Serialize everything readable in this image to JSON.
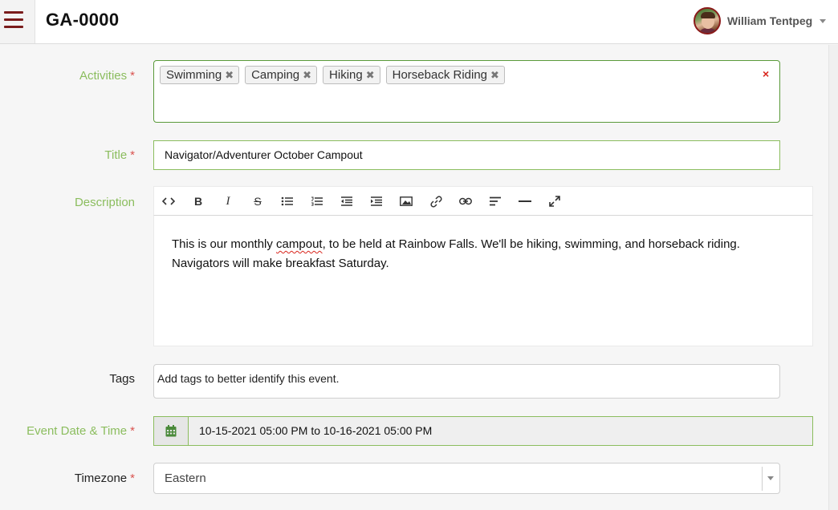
{
  "header": {
    "app_title": "GA-0000",
    "user_name": "William Tentpeg"
  },
  "form": {
    "activities": {
      "label": "Activities",
      "required_mark": "*",
      "chips": [
        "Swimming",
        "Camping",
        "Hiking",
        "Horseback Riding"
      ],
      "chip_remove_glyph": "✖",
      "clear_glyph": "×"
    },
    "title": {
      "label": "Title",
      "required_mark": "*",
      "value": "Navigator/Adventurer October Campout"
    },
    "description": {
      "label": "Description",
      "toolbar": [
        "code-icon",
        "bold-icon",
        "italic-icon",
        "strikethrough-icon",
        "bulleted-list-icon",
        "numbered-list-icon",
        "outdent-icon",
        "indent-icon",
        "image-icon",
        "link-icon",
        "unlink-icon",
        "align-left-icon",
        "horizontal-rule-icon",
        "fullscreen-icon"
      ],
      "text_before": "This is our monthly ",
      "misspelled_word": "campout",
      "text_after": ", to be held at Rainbow Falls.  We'll be hiking, swimming, and horseback riding.",
      "line2": "Navigators will make breakfast Saturday."
    },
    "tags": {
      "label": "Tags",
      "placeholder": "Add tags to better identify this event."
    },
    "event_date": {
      "label": "Event Date & Time",
      "required_mark": "*",
      "value": "10-15-2021 05:00 PM to 10-16-2021 05:00 PM"
    },
    "timezone": {
      "label": "Timezone",
      "required_mark": "*",
      "value": "Eastern"
    }
  },
  "colors": {
    "brand": "#7a1c1c",
    "label_green": "#8bbd5e",
    "required_red": "#d9534f"
  }
}
